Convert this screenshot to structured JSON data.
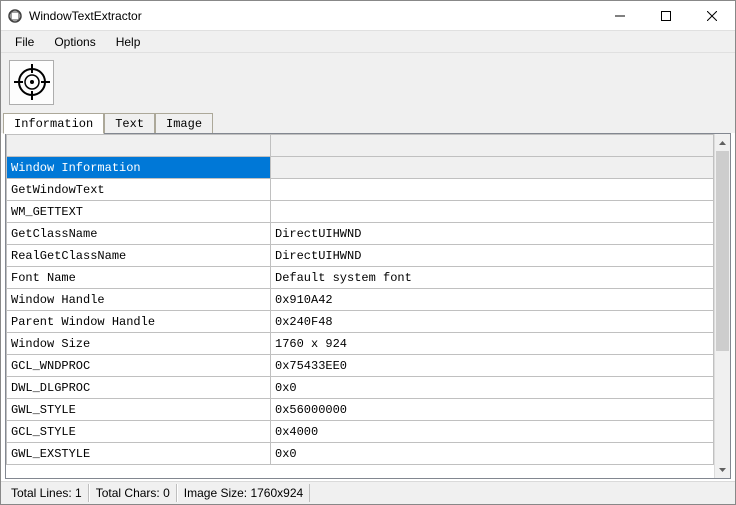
{
  "window": {
    "title": "WindowTextExtractor"
  },
  "menu": {
    "file": "File",
    "options": "Options",
    "help": "Help"
  },
  "tabs": {
    "information": "Information",
    "text": "Text",
    "image": "Image"
  },
  "table": {
    "section_header": "Window Information",
    "rows": [
      {
        "k": "GetWindowText",
        "v": ""
      },
      {
        "k": "WM_GETTEXT",
        "v": ""
      },
      {
        "k": "GetClassName",
        "v": "DirectUIHWND"
      },
      {
        "k": "RealGetClassName",
        "v": "DirectUIHWND"
      },
      {
        "k": "Font Name",
        "v": "Default system font"
      },
      {
        "k": "Window Handle",
        "v": "0x910A42"
      },
      {
        "k": "Parent Window Handle",
        "v": "0x240F48"
      },
      {
        "k": "Window Size",
        "v": "1760 x 924"
      },
      {
        "k": "GCL_WNDPROC",
        "v": "0x75433EE0"
      },
      {
        "k": "DWL_DLGPROC",
        "v": "0x0"
      },
      {
        "k": "GWL_STYLE",
        "v": "0x56000000"
      },
      {
        "k": "GCL_STYLE",
        "v": "0x4000"
      },
      {
        "k": "GWL_EXSTYLE",
        "v": "0x0"
      }
    ]
  },
  "status": {
    "total_lines": "Total Lines: 1",
    "total_chars": "Total Chars: 0",
    "image_size": "Image Size: 1760x924"
  }
}
